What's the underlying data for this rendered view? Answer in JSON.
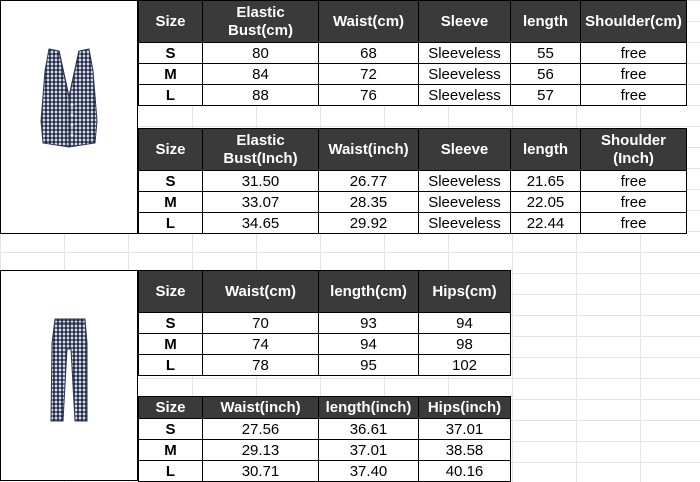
{
  "colors": {
    "header_bg": "#3a3a3a",
    "header_text": "#ffffff",
    "grid_line": "#e4e4e4",
    "garment_navy": "#2b3550"
  },
  "vest": {
    "image_icon": "gingham-vest-image",
    "cm": {
      "headers": [
        "Size",
        "Elastic Bust(cm)",
        "Waist(cm)",
        "Sleeve",
        "length",
        "Shoulder(cm)"
      ],
      "rows": [
        [
          "S",
          "80",
          "68",
          "Sleeveless",
          "55",
          "free"
        ],
        [
          "M",
          "84",
          "72",
          "Sleeveless",
          "56",
          "free"
        ],
        [
          "L",
          "88",
          "76",
          "Sleeveless",
          "57",
          "free"
        ]
      ]
    },
    "inch": {
      "headers": [
        "Size",
        "Elastic Bust(Inch)",
        "Waist(inch)",
        "Sleeve",
        "length",
        "Shoulder (Inch)"
      ],
      "rows": [
        [
          "S",
          "31.50",
          "26.77",
          "Sleeveless",
          "21.65",
          "free"
        ],
        [
          "M",
          "33.07",
          "28.35",
          "Sleeveless",
          "22.05",
          "free"
        ],
        [
          "L",
          "34.65",
          "29.92",
          "Sleeveless",
          "22.44",
          "free"
        ]
      ]
    }
  },
  "pants": {
    "image_icon": "gingham-pants-image",
    "cm": {
      "headers": [
        "Size",
        "Waist(cm)",
        "length(cm)",
        "Hips(cm)"
      ],
      "rows": [
        [
          "S",
          "70",
          "93",
          "94"
        ],
        [
          "M",
          "74",
          "94",
          "98"
        ],
        [
          "L",
          "78",
          "95",
          "102"
        ]
      ]
    },
    "inch": {
      "headers": [
        "Size",
        "Waist(inch)",
        "length(inch)",
        "Hips(inch)"
      ],
      "rows": [
        [
          "S",
          "27.56",
          "36.61",
          "37.01"
        ],
        [
          "M",
          "29.13",
          "37.01",
          "38.58"
        ],
        [
          "L",
          "30.71",
          "37.40",
          "40.16"
        ]
      ]
    }
  }
}
